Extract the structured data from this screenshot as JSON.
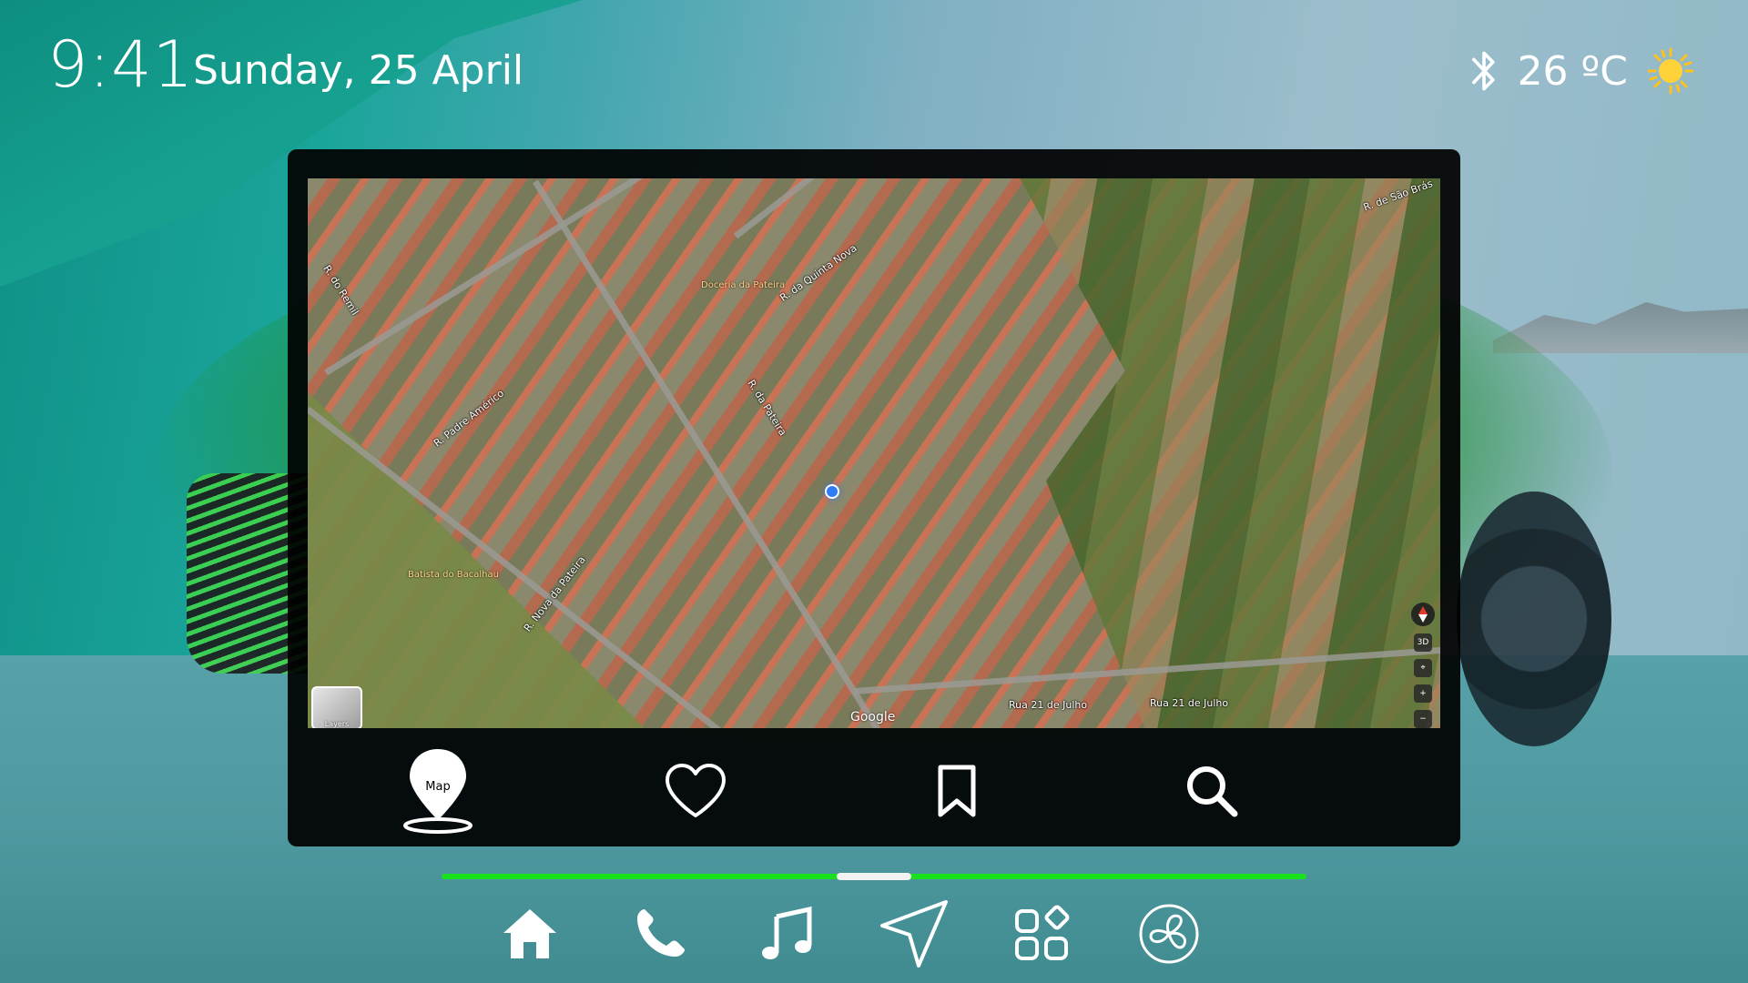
{
  "status": {
    "time": "9:41",
    "date": "Sunday, 25 April",
    "temperature": "26 ºC",
    "bluetooth_icon": "bluetooth-icon",
    "weather_icon": "sun-icon"
  },
  "map": {
    "streets": [
      "R. Padre Américo",
      "R. da Quinta Nova",
      "R. da Pateira",
      "R. de São Brás",
      "Rua 21 de Julho",
      "R. do Remil",
      "R. Nova da Pateira",
      "Rua 21 de Julho"
    ],
    "pois": [
      "Doceria da Pateira",
      "Batista do Bacalhau"
    ],
    "attribution": "Google",
    "layers_label": "Layers",
    "controls": [
      "3D",
      "⌖",
      "+",
      "−"
    ]
  },
  "panel_tabs": [
    {
      "label": "Map",
      "icon": "map-pin-icon",
      "active": true
    },
    {
      "label": "",
      "icon": "heart-icon"
    },
    {
      "label": "",
      "icon": "bookmark-icon"
    },
    {
      "label": "",
      "icon": "search-icon"
    }
  ],
  "progress": {
    "thumb_position": 0.5
  },
  "dock": [
    {
      "icon": "home-icon"
    },
    {
      "icon": "phone-icon"
    },
    {
      "icon": "music-icon"
    },
    {
      "icon": "navigation-icon"
    },
    {
      "icon": "apps-icon"
    },
    {
      "icon": "fan-icon"
    }
  ],
  "colors": {
    "accent": "#1ae21a",
    "panel": "#000000"
  }
}
